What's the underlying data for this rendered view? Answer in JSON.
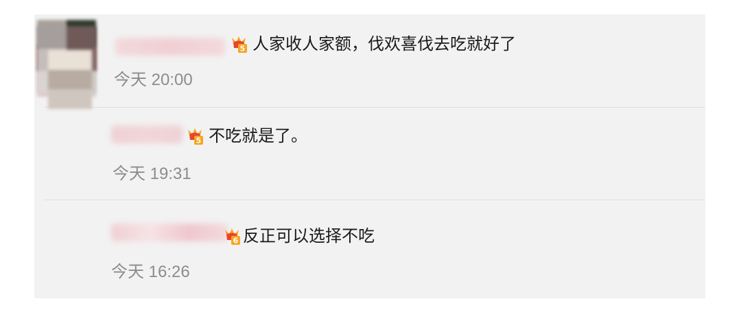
{
  "comments": [
    {
      "badge_level": "5",
      "text": "人家收人家额，伐欢喜伐去吃就好了",
      "time": "今天 20:00"
    },
    {
      "badge_level": "5",
      "text": "不吃就是了。",
      "time": "今天 19:31"
    },
    {
      "badge_level": "6",
      "text": "反正可以选择不吃",
      "time": "今天 16:26"
    }
  ],
  "colors": {
    "panel_bg": "#f2f2f2",
    "badge_orange": "#f5a623",
    "badge_red": "#e8452f",
    "time_gray": "#8c8c8c"
  }
}
